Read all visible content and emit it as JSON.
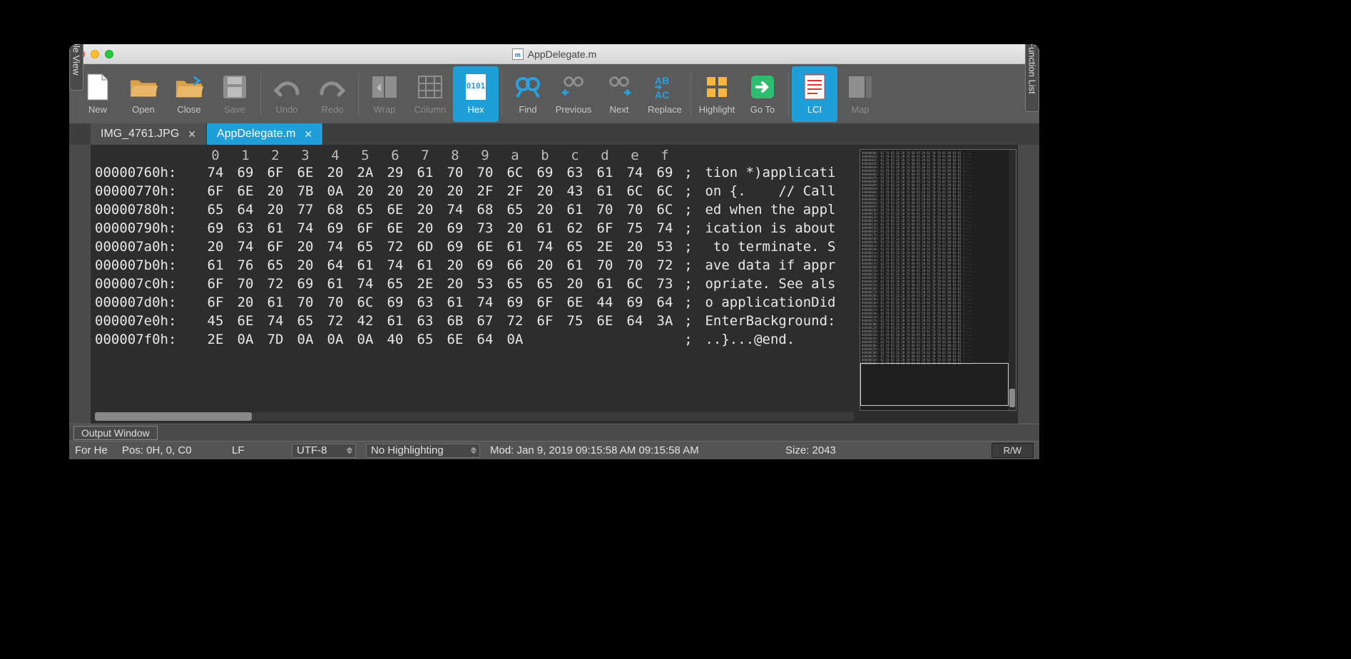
{
  "window": {
    "title": "AppDelegate.m"
  },
  "toolbar": {
    "new": "New",
    "open": "Open",
    "close": "Close",
    "save": "Save",
    "undo": "Undo",
    "redo": "Redo",
    "wrap": "Wrap",
    "column": "Column",
    "hex": "Hex",
    "find": "Find",
    "previous": "Previous",
    "next": "Next",
    "replace": "Replace",
    "highlight": "Highlight",
    "goto": "Go To",
    "lci": "LCI",
    "map": "Map"
  },
  "tabs": [
    {
      "label": "IMG_4761.JPG",
      "active": false
    },
    {
      "label": "AppDelegate.m",
      "active": true
    }
  ],
  "side": {
    "file_view": "File View",
    "function_list": "Function List"
  },
  "hex": {
    "columns": [
      "0",
      "1",
      "2",
      "3",
      "4",
      "5",
      "6",
      "7",
      "8",
      "9",
      "a",
      "b",
      "c",
      "d",
      "e",
      "f"
    ],
    "rows": [
      {
        "addr": "00000760h:",
        "bytes": [
          "74",
          "69",
          "6F",
          "6E",
          "20",
          "2A",
          "29",
          "61",
          "70",
          "70",
          "6C",
          "69",
          "63",
          "61",
          "74",
          "69"
        ],
        "asc": "tion *)applicati"
      },
      {
        "addr": "00000770h:",
        "bytes": [
          "6F",
          "6E",
          "20",
          "7B",
          "0A",
          "20",
          "20",
          "20",
          "20",
          "2F",
          "2F",
          "20",
          "43",
          "61",
          "6C",
          "6C"
        ],
        "asc": "on {.    // Call"
      },
      {
        "addr": "00000780h:",
        "bytes": [
          "65",
          "64",
          "20",
          "77",
          "68",
          "65",
          "6E",
          "20",
          "74",
          "68",
          "65",
          "20",
          "61",
          "70",
          "70",
          "6C"
        ],
        "asc": "ed when the appl"
      },
      {
        "addr": "00000790h:",
        "bytes": [
          "69",
          "63",
          "61",
          "74",
          "69",
          "6F",
          "6E",
          "20",
          "69",
          "73",
          "20",
          "61",
          "62",
          "6F",
          "75",
          "74"
        ],
        "asc": "ication is about"
      },
      {
        "addr": "000007a0h:",
        "bytes": [
          "20",
          "74",
          "6F",
          "20",
          "74",
          "65",
          "72",
          "6D",
          "69",
          "6E",
          "61",
          "74",
          "65",
          "2E",
          "20",
          "53"
        ],
        "asc": " to terminate. S"
      },
      {
        "addr": "000007b0h:",
        "bytes": [
          "61",
          "76",
          "65",
          "20",
          "64",
          "61",
          "74",
          "61",
          "20",
          "69",
          "66",
          "20",
          "61",
          "70",
          "70",
          "72"
        ],
        "asc": "ave data if appr"
      },
      {
        "addr": "000007c0h:",
        "bytes": [
          "6F",
          "70",
          "72",
          "69",
          "61",
          "74",
          "65",
          "2E",
          "20",
          "53",
          "65",
          "65",
          "20",
          "61",
          "6C",
          "73"
        ],
        "asc": "opriate. See als"
      },
      {
        "addr": "000007d0h:",
        "bytes": [
          "6F",
          "20",
          "61",
          "70",
          "70",
          "6C",
          "69",
          "63",
          "61",
          "74",
          "69",
          "6F",
          "6E",
          "44",
          "69",
          "64"
        ],
        "asc": "o applicationDid"
      },
      {
        "addr": "000007e0h:",
        "bytes": [
          "45",
          "6E",
          "74",
          "65",
          "72",
          "42",
          "61",
          "63",
          "6B",
          "67",
          "72",
          "6F",
          "75",
          "6E",
          "64",
          "3A"
        ],
        "asc": "EnterBackground:"
      },
      {
        "addr": "000007f0h:",
        "bytes": [
          "2E",
          "0A",
          "7D",
          "0A",
          "0A",
          "0A",
          "40",
          "65",
          "6E",
          "64",
          "0A",
          "",
          "",
          "",
          "",
          ""
        ],
        "asc": "..}...@end."
      }
    ]
  },
  "output": {
    "label": "Output Window"
  },
  "status": {
    "context": "For He",
    "pos": "Pos: 0H, 0, C0",
    "le": "LF",
    "enc": "UTF-8",
    "hl": "No Highlighting",
    "mod": "Mod: Jan 9, 2019 09:15:58 AM 09:15:58 AM",
    "size": "Size: 2043",
    "rw": "R/W"
  }
}
